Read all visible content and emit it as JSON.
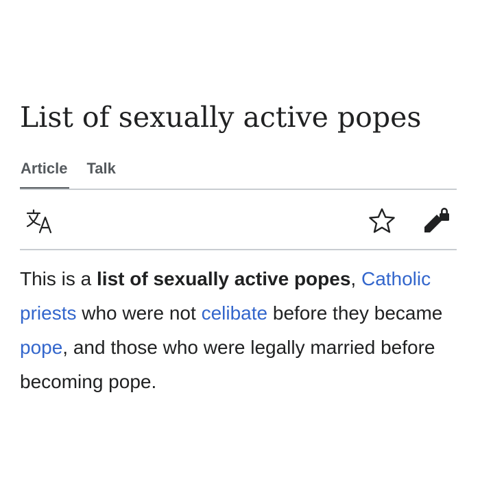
{
  "page": {
    "title": "List of sexually active popes"
  },
  "tabs": [
    {
      "label": "Article",
      "selected": true
    },
    {
      "label": "Talk",
      "selected": false
    }
  ],
  "toolbar": {
    "icons": [
      "language-icon",
      "star-icon",
      "edit-locked-icon"
    ]
  },
  "lead": {
    "t1": "This is a ",
    "bold": "list of sexually active popes",
    "t2": ", ",
    "link1": "Catholic priests",
    "t3": " who were not ",
    "link2": "celibate",
    "t4": " before they became ",
    "link3": "pope",
    "t5": ", and those who were legally married before becoming pope."
  },
  "colors": {
    "text": "#202122",
    "link": "#3366cc",
    "tab_text": "#54595d",
    "divider": "#c8ccd1",
    "background": "#ffffff"
  }
}
